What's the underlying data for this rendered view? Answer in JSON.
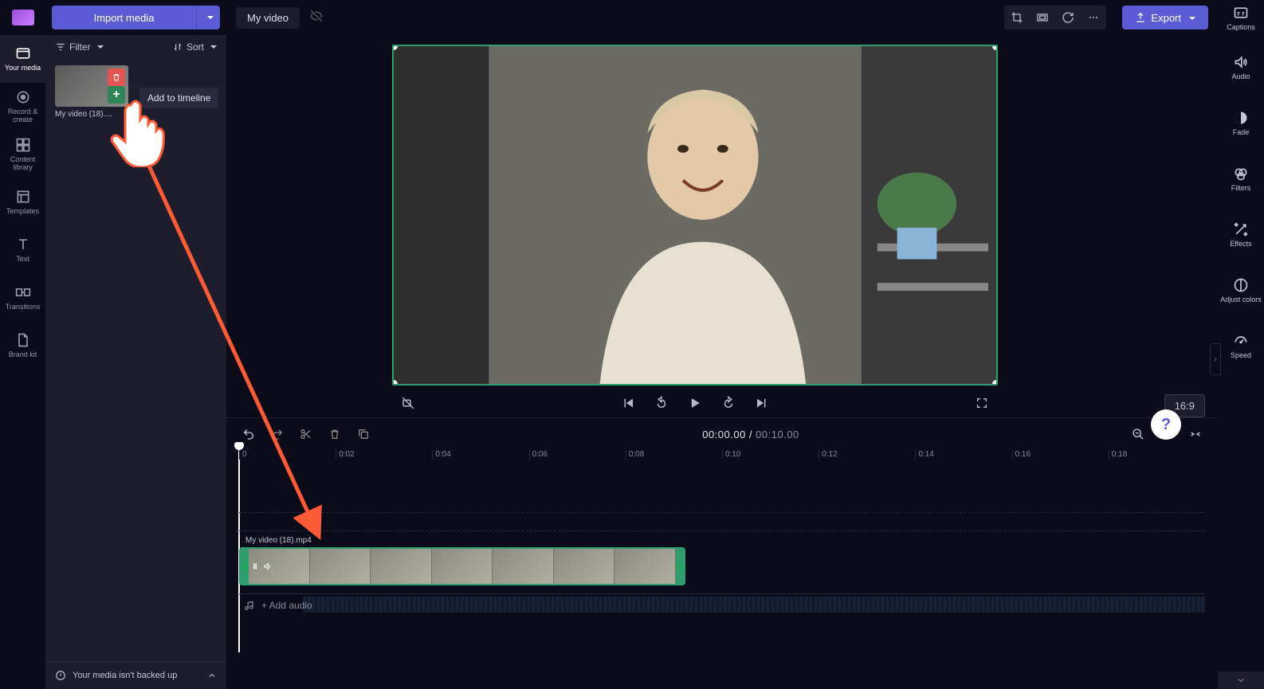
{
  "import": {
    "button": "Import media"
  },
  "title": "My video",
  "toolbar": {
    "crop": "crop",
    "fit": "fit",
    "rotate": "rotate",
    "more": "more"
  },
  "export": "Export",
  "captions": "Captions",
  "nav": [
    {
      "label": "Your media"
    },
    {
      "label": "Record & create"
    },
    {
      "label": "Content library"
    },
    {
      "label": "Templates"
    },
    {
      "label": "Text"
    },
    {
      "label": "Transitions"
    },
    {
      "label": "Brand kit"
    }
  ],
  "filter_label": "Filter",
  "sort_label": "Sort",
  "media_item": {
    "name": "My video (18)...."
  },
  "tooltip": "Add to timeline",
  "backup_msg": "Your media isn't backed up",
  "aspect": "16:9",
  "timecode": {
    "current": "00:00.00",
    "sep": " / ",
    "total": "00:10.00"
  },
  "ruler": [
    "0",
    "0:02",
    "0:04",
    "0:06",
    "0:08",
    "0:10",
    "0:12",
    "0:14",
    "0:16",
    "0:18"
  ],
  "clip_name": "My video (18).mp4",
  "add_audio": "+ Add audio",
  "properties": [
    {
      "label": "Audio"
    },
    {
      "label": "Fade"
    },
    {
      "label": "Filters"
    },
    {
      "label": "Effects"
    },
    {
      "label": "Adjust colors"
    },
    {
      "label": "Speed"
    }
  ],
  "help": "?"
}
